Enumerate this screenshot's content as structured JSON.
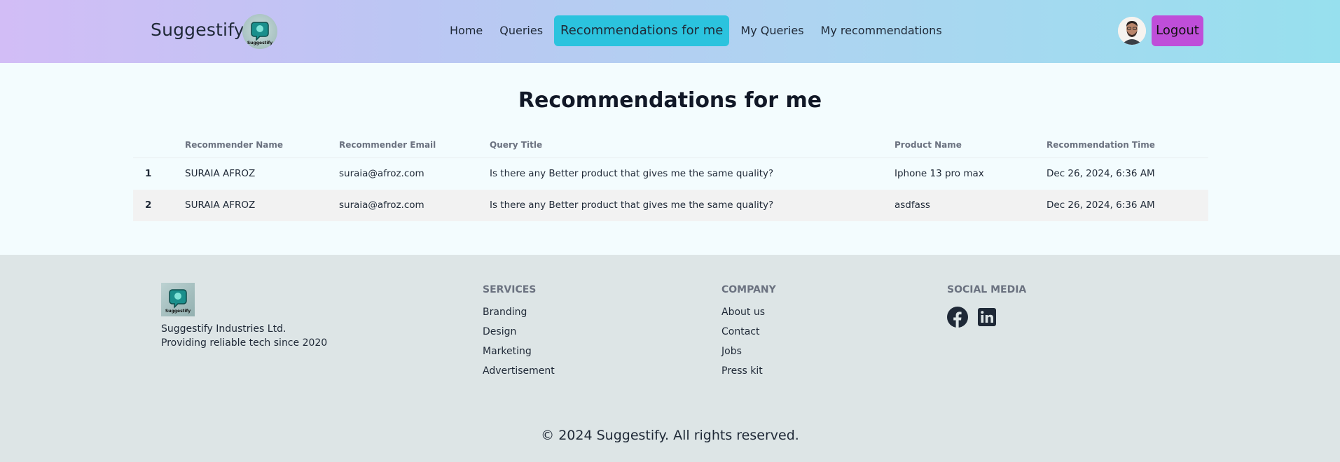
{
  "navbar": {
    "brand": "Suggestify",
    "links": [
      "Home",
      "Queries",
      "Recommendations for me",
      "My Queries",
      "My recommendations"
    ],
    "logout_label": "Logout"
  },
  "main": {
    "title": "Recommendations for me",
    "columns": [
      "Recommender Name",
      "Recommender Email",
      "Query Title",
      "Product Name",
      "Recommendation Time"
    ],
    "rows": [
      {
        "num": "1",
        "name": "SURAIA AFROZ",
        "email": "suraia@afroz.com",
        "query": "Is there any Better product that gives me the same quality?",
        "product": "Iphone 13 pro max",
        "time": "Dec 26, 2024, 6:36 AM"
      },
      {
        "num": "2",
        "name": "SURAIA AFROZ",
        "email": "suraia@afroz.com",
        "query": "Is there any Better product that gives me the same quality?",
        "product": "asdfass",
        "time": "Dec 26, 2024, 6:36 AM"
      }
    ]
  },
  "footer": {
    "company_name": "Suggestify Industries Ltd.",
    "tagline": "Providing reliable tech since 2020",
    "services_heading": "SERVICES",
    "services": [
      "Branding",
      "Design",
      "Marketing",
      "Advertisement"
    ],
    "company_heading": "COMPANY",
    "company_links": [
      "About us",
      "Contact",
      "Jobs",
      "Press kit"
    ],
    "social_heading": "SOCIAL MEDIA",
    "social_icons": [
      "facebook-icon",
      "linkedin-icon"
    ],
    "copyright": "© 2024 Suggestify. All rights reserved."
  },
  "colors": {
    "active_tab": "#2bc3de",
    "logout_button": "#bf4ed9",
    "footer_bg": "#dde5e6",
    "page_bg": "#f3fcfe"
  }
}
